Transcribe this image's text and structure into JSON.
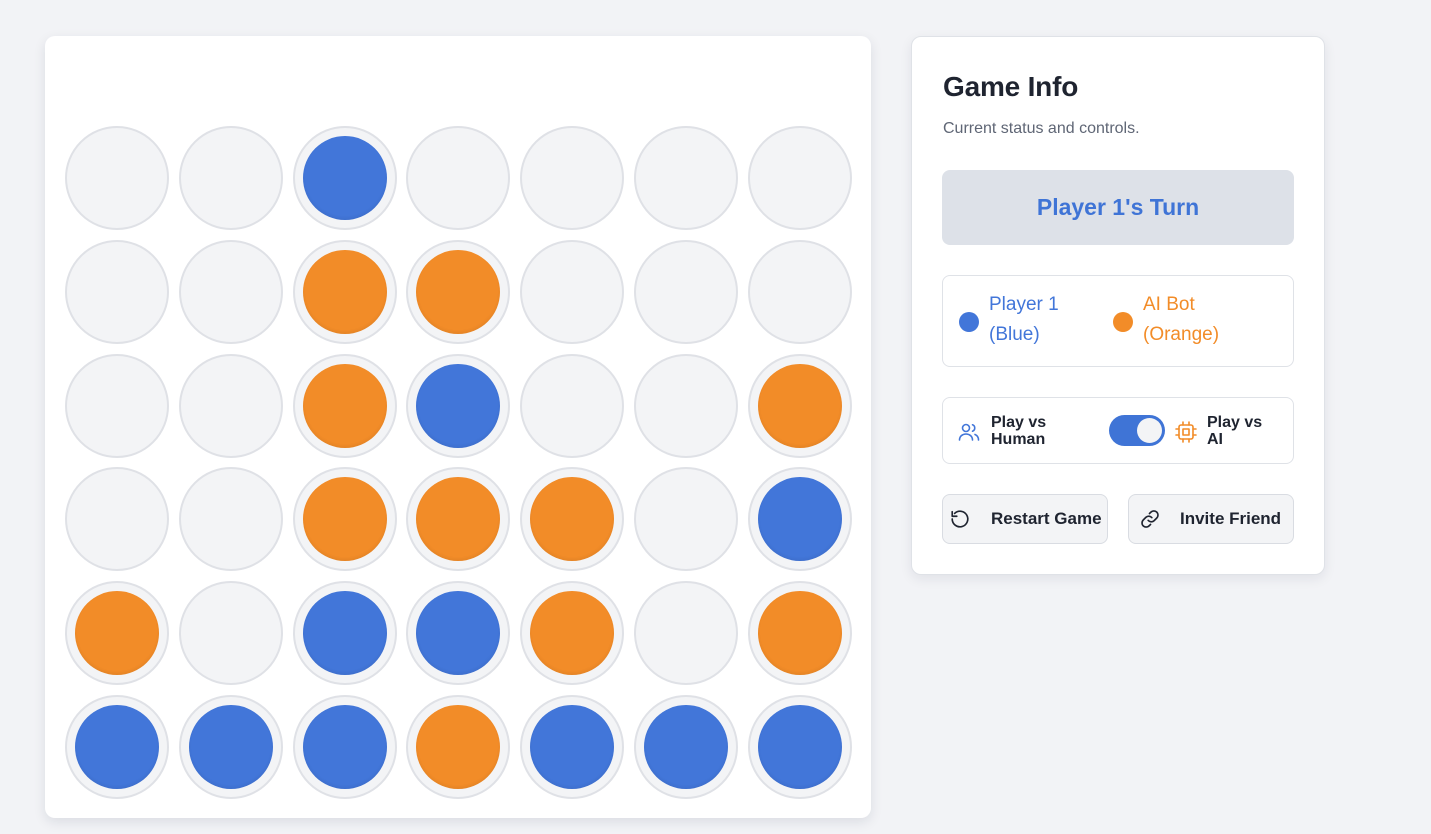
{
  "board": {
    "rows": [
      [
        "empty",
        "empty",
        "blue",
        "empty",
        "empty",
        "empty",
        "empty"
      ],
      [
        "empty",
        "empty",
        "orange",
        "orange",
        "empty",
        "empty",
        "empty"
      ],
      [
        "empty",
        "empty",
        "orange",
        "blue",
        "empty",
        "empty",
        "orange"
      ],
      [
        "empty",
        "empty",
        "orange",
        "orange",
        "orange",
        "empty",
        "blue"
      ],
      [
        "orange",
        "empty",
        "blue",
        "blue",
        "orange",
        "empty",
        "orange"
      ],
      [
        "blue",
        "blue",
        "blue",
        "orange",
        "blue",
        "blue",
        "blue"
      ]
    ]
  },
  "colors": {
    "blue": "#4276d9",
    "orange": "#f28c28",
    "accent": "#3f74d6"
  },
  "info": {
    "title": "Game Info",
    "subtitle": "Current status and controls.",
    "turn_status": "Player 1's Turn"
  },
  "legend": {
    "player1": "Player 1 (Blue)",
    "player2": "AI Bot (Orange)"
  },
  "mode": {
    "human_label": "Play vs Human",
    "ai_label": "Play vs AI",
    "ai_enabled": true,
    "human_icon": "users-icon",
    "ai_icon": "cpu-chip-icon"
  },
  "actions": {
    "restart_label": "Restart Game",
    "restart_icon": "rotate-ccw-icon",
    "invite_label": "Invite Friend",
    "invite_icon": "link-icon"
  }
}
